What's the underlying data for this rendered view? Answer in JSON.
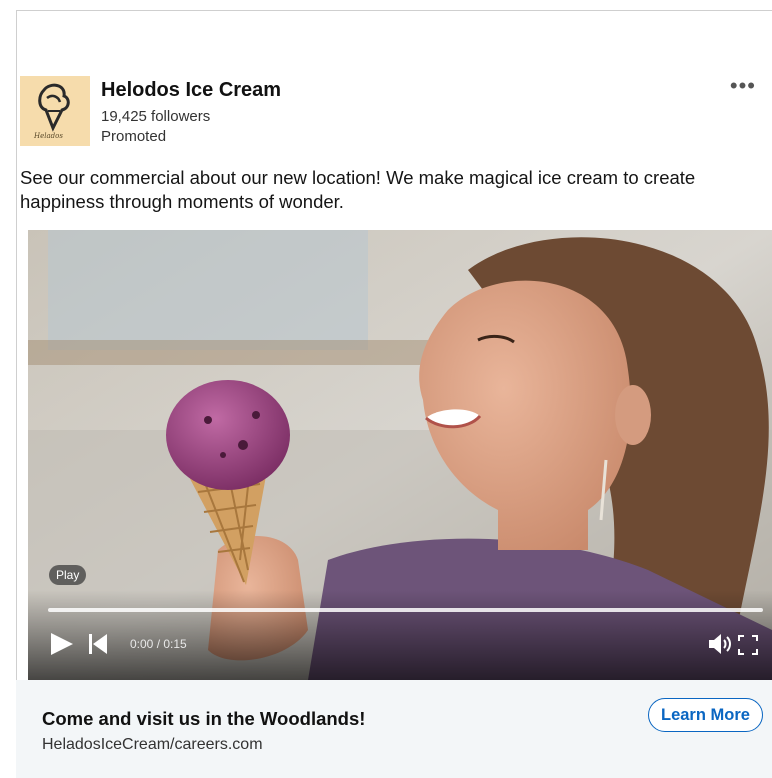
{
  "company": {
    "name": "Helodos Ice Cream",
    "followers": "19,425 followers",
    "promoted": "Promoted",
    "logo_script": "Helados"
  },
  "post": {
    "caption": "See our commercial about our new location! We make magical ice cream to create happiness through moments of wonder."
  },
  "video": {
    "play_tooltip": "Play",
    "time": "0:00 / 0:15",
    "progress": 0
  },
  "footer": {
    "title": "Come and visit us in the Woodlands!",
    "url": "HeladosIceCream/careers.com",
    "cta_label": "Learn More"
  },
  "menu": {
    "more_label": "•••"
  },
  "colors": {
    "accent": "#0a66c2",
    "logo_bg": "#f6dcac",
    "footer_bg": "#f3f6f8",
    "ice_cream": "#9b3f7e"
  }
}
